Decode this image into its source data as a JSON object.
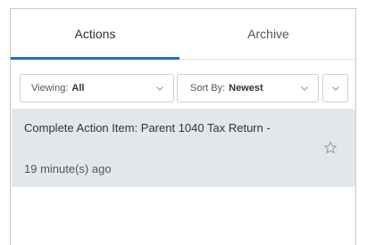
{
  "tabs": [
    {
      "label": "Actions",
      "active": true
    },
    {
      "label": "Archive",
      "active": false
    }
  ],
  "filters": {
    "viewing_label": "Viewing:",
    "viewing_value": "All",
    "sort_label": "Sort By:",
    "sort_value": "Newest"
  },
  "items": [
    {
      "title": "Complete Action Item: Parent 1040 Tax Return -",
      "time": "19 minute(s) ago",
      "starred": false
    }
  ],
  "icons": {
    "chevron": "chevron-down-icon",
    "star": "star-outline-icon"
  },
  "colors": {
    "active_tab_underline": "#1a73c4",
    "item_background": "#e4e7ea"
  }
}
